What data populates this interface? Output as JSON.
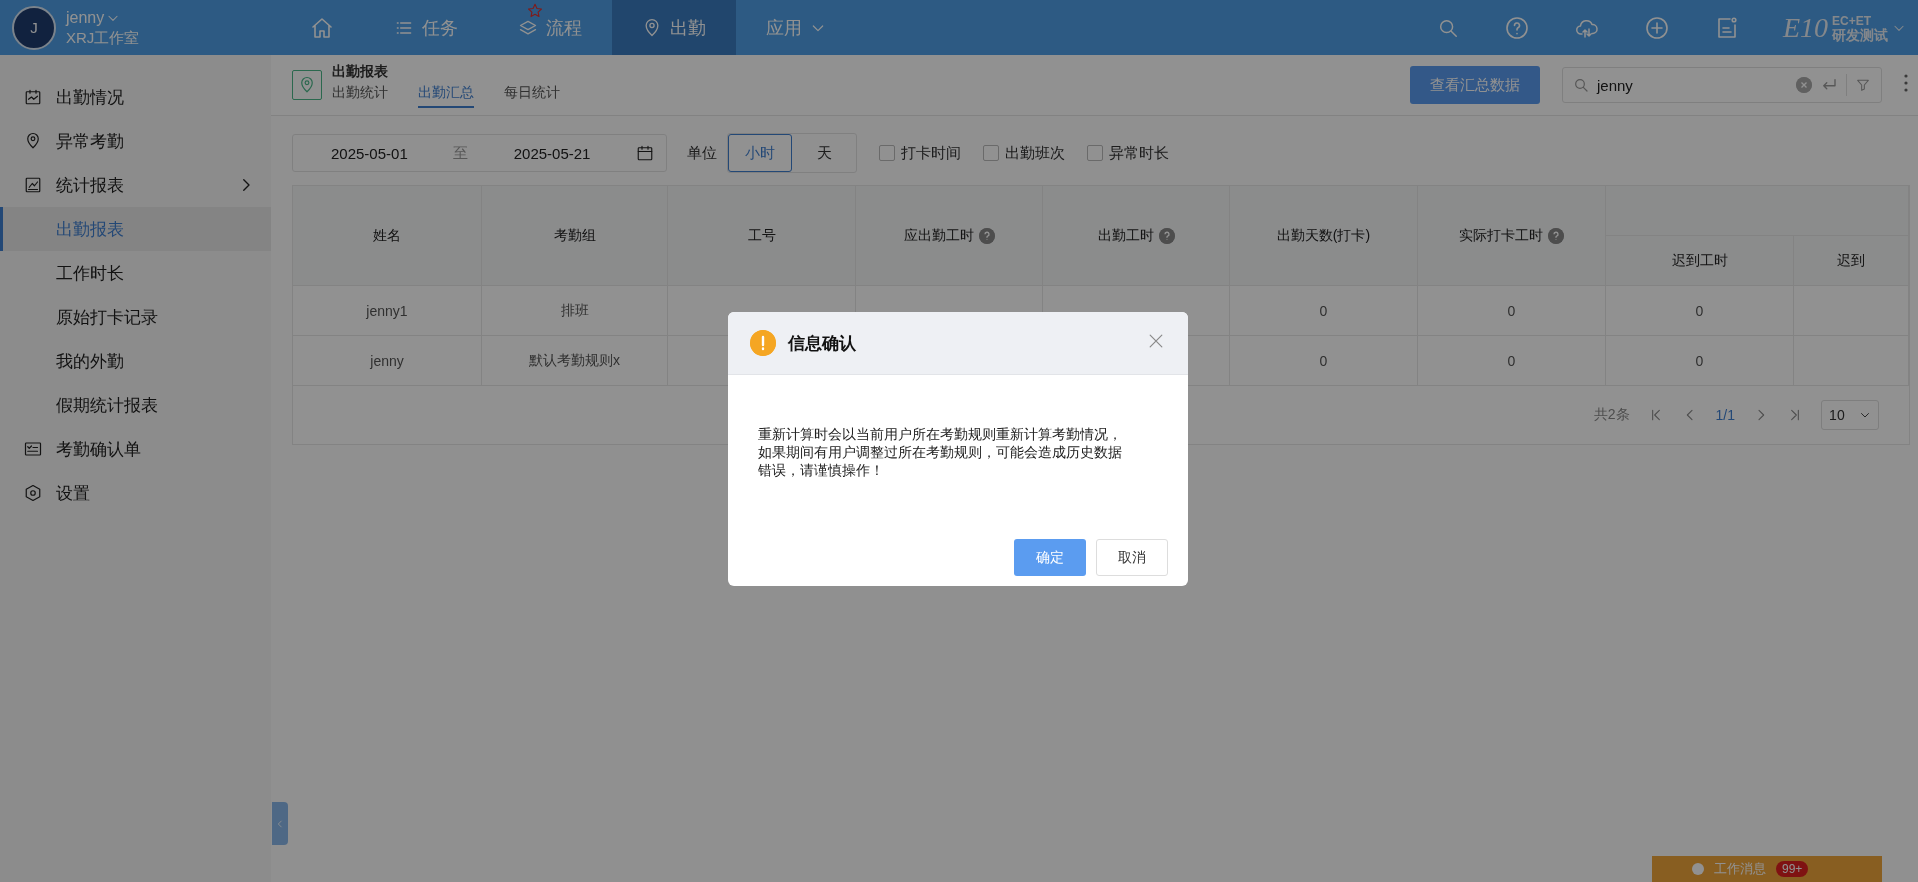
{
  "header": {
    "avatar": "J",
    "user": "jenny",
    "org": "XRJ工作室"
  },
  "nav": [
    {
      "kind": "home",
      "selected": false,
      "starred": false
    },
    {
      "kind": "list",
      "label": "任务",
      "selected": false,
      "starred": false
    },
    {
      "kind": "layers",
      "label": "流程",
      "selected": false,
      "starred": true
    },
    {
      "kind": "pin",
      "label": "出勤",
      "selected": true,
      "starred": false
    },
    {
      "kind": "menu",
      "label": "应用",
      "selected": false,
      "starred": false
    }
  ],
  "brand": {
    "main": "E10",
    "top": "EC+ET",
    "bottom": "研发测试"
  },
  "sidebar": {
    "items": [
      {
        "kind": "calendar",
        "label": "出勤情况",
        "selected": false
      },
      {
        "kind": "pin",
        "label": "异常考勤",
        "selected": false
      },
      {
        "kind": "chart",
        "label": "统计报表",
        "selected": false,
        "children": [
          {
            "label": "出勤报表",
            "selected": true
          },
          {
            "label": "工作时长",
            "selected": false
          },
          {
            "label": "原始打卡记录",
            "selected": false
          },
          {
            "label": "我的外勤",
            "selected": false
          },
          {
            "label": "假期统计报表",
            "selected": false
          }
        ]
      },
      {
        "kind": "form",
        "label": "考勤确认单",
        "selected": false
      },
      {
        "kind": "gear",
        "label": "设置",
        "selected": false
      }
    ]
  },
  "page": {
    "title": "出勤报表",
    "tabs": [
      {
        "label": "出勤统计",
        "selected": false
      },
      {
        "label": "出勤汇总",
        "selected": true
      },
      {
        "label": "每日统计",
        "selected": false
      }
    ],
    "summary_button": "查看汇总数据",
    "search": {
      "value": "jenny"
    }
  },
  "filters": {
    "date_from": "2025-05-01",
    "separator": "至",
    "date_to": "2025-05-21",
    "unit_label": "单位",
    "units": [
      {
        "label": "小时",
        "selected": true
      },
      {
        "label": "天",
        "selected": false
      }
    ],
    "checkboxes": [
      {
        "label": "打卡时间",
        "checked": false
      },
      {
        "label": "出勤班次",
        "checked": false
      },
      {
        "label": "异常时长",
        "checked": false
      }
    ]
  },
  "table": {
    "columns": [
      {
        "label": "姓名",
        "help": false
      },
      {
        "label": "考勤组",
        "help": false
      },
      {
        "label": "工号",
        "help": false
      },
      {
        "label": "应出勤工时",
        "help": true
      },
      {
        "label": "出勤工时",
        "help": true
      },
      {
        "label": "出勤天数(打卡)",
        "help": false
      },
      {
        "label": "实际打卡工时",
        "help": true
      },
      {
        "label": "迟到工时",
        "help": false
      },
      {
        "label": "迟到",
        "help": false
      }
    ],
    "rows": [
      [
        "jenny1",
        "排班",
        null,
        null,
        null,
        "0",
        "0",
        "0",
        null
      ],
      [
        "jenny",
        "默认考勤规则x",
        null,
        null,
        null,
        "0",
        "0",
        "0",
        null
      ]
    ]
  },
  "pagination": {
    "total": "共2条",
    "page": "1/1",
    "page_size": "10"
  },
  "dialog": {
    "title": "信息确认",
    "message": "重新计算时会以当前用户所在考勤规则重新计算考勤情况，如果期间有用户调整过所在考勤规则，可能会造成历史数据错误，请谨慎操作！",
    "confirm": "确定",
    "cancel": "取消"
  },
  "messages": {
    "label": "工作消息",
    "badge": "99+"
  }
}
